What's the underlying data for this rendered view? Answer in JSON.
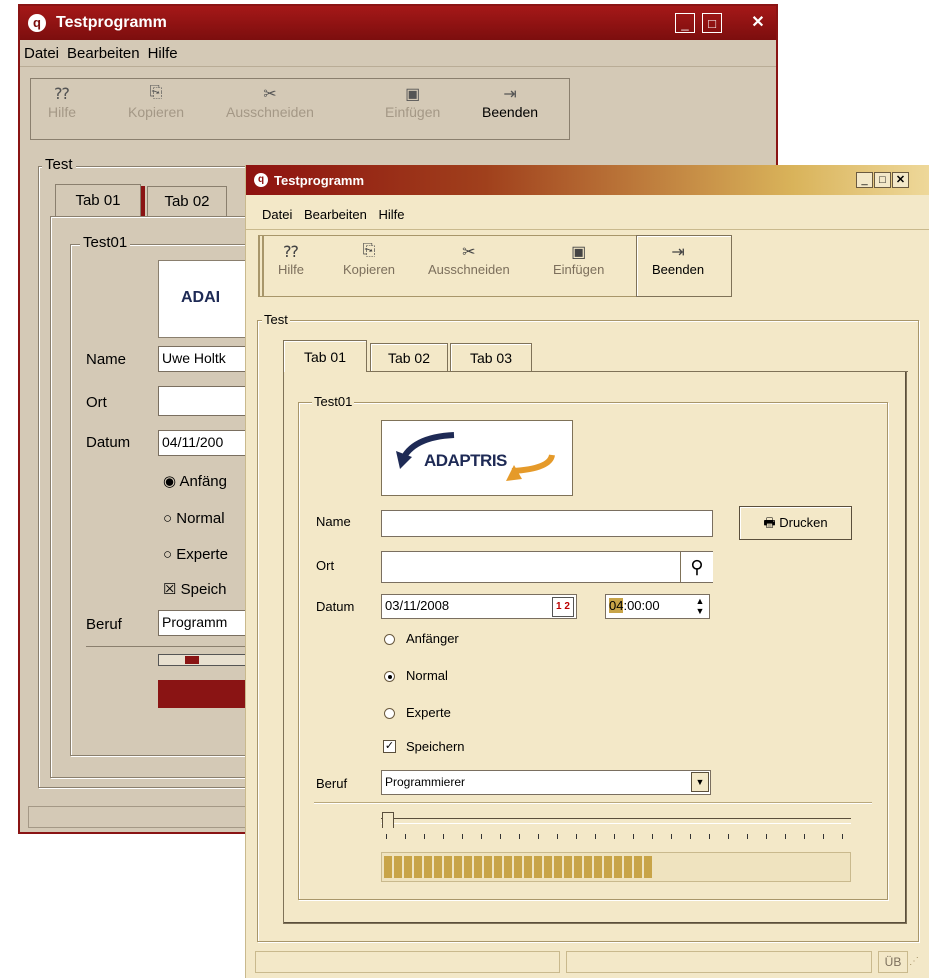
{
  "window_back": {
    "title": "Testprogramm",
    "menu": [
      "Datei",
      "Bearbeiten",
      "Hilfe"
    ],
    "toolbar": [
      "Hilfe",
      "Kopieren",
      "Ausschneiden",
      "Einfügen",
      "Beenden"
    ],
    "groupbox": "Test",
    "tabs": [
      "Tab 01",
      "Tab 02"
    ],
    "inner_group": "Test01",
    "logo_text": "ADAI",
    "labels": {
      "name": "Name",
      "ort": "Ort",
      "datum": "Datum",
      "beruf": "Beruf"
    },
    "name_value": "Uwe Holtk",
    "ort_value": "",
    "datum_value": "04/11/200",
    "radios": [
      "Anfäng",
      "Normal",
      "Experte"
    ],
    "checkbox": "Speich",
    "beruf_value": "Programm"
  },
  "window_front": {
    "title": "Testprogramm",
    "menu": [
      "Datei",
      "Bearbeiten",
      "Hilfe"
    ],
    "toolbar": [
      "Hilfe",
      "Kopieren",
      "Ausschneiden",
      "Einfügen",
      "Beenden"
    ],
    "groupbox": "Test",
    "tabs": [
      "Tab 01",
      "Tab 02",
      "Tab 03"
    ],
    "inner_group": "Test01",
    "logo_text": "ADAPTRIS",
    "labels": {
      "name": "Name",
      "ort": "Ort",
      "datum": "Datum",
      "beruf": "Beruf"
    },
    "name_value": "",
    "ort_value": "",
    "datum_value": "03/11/2008",
    "time_hour": "04",
    "time_rest": ":00:00",
    "radios": [
      "Anfänger",
      "Normal",
      "Experte"
    ],
    "radio_selected": "Normal",
    "checkbox": "Speichern",
    "checkbox_checked": true,
    "beruf_value": "Programmierer",
    "print_button": "Drucken",
    "progress_fraction": 0.58,
    "status_right": "ÜB"
  },
  "colors": {
    "back_title": "#8a1414",
    "front_bg": "#f3e8c8",
    "progress": "#c8a448"
  }
}
